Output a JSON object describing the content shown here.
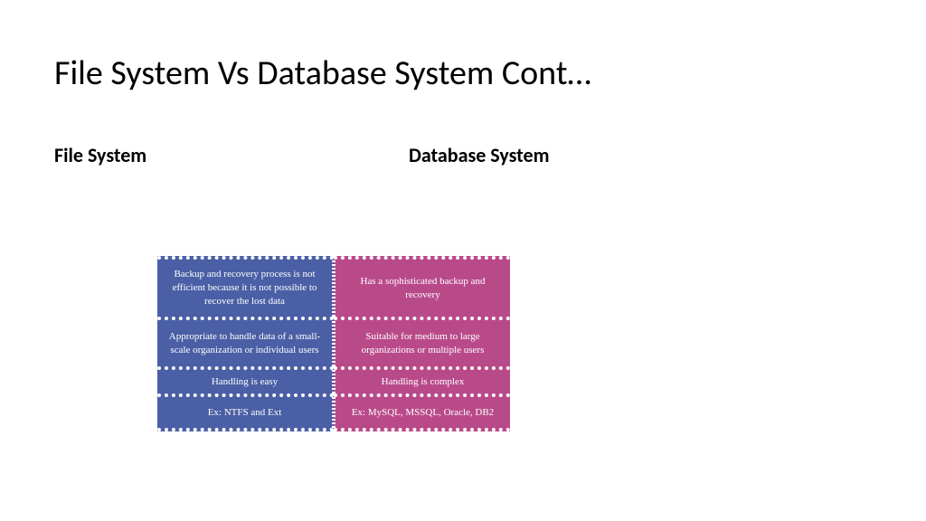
{
  "title": "File System Vs Database System Cont…",
  "headers": {
    "left": "File System",
    "right": "Database System"
  },
  "table": {
    "left": [
      "Backup and recovery process is not efficient because it is not possible to recover the lost data",
      "Appropriate to handle data of a small-scale organization or individual users",
      "Handling is easy",
      "Ex: NTFS and Ext"
    ],
    "right": [
      "Has a sophisticated backup and recovery",
      "Suitable for medium to large organizations or multiple users",
      "Handling is complex",
      "Ex: MySQL, MSSQL, Oracle, DB2"
    ]
  }
}
